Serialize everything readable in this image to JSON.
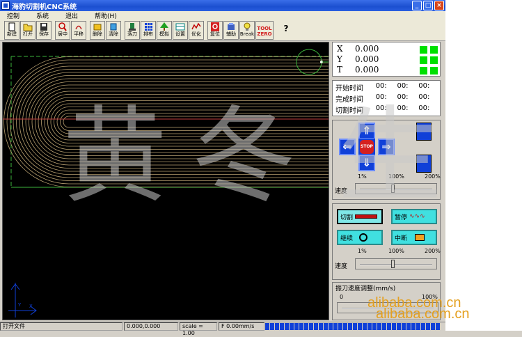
{
  "window": {
    "title": "海豹切割机CNC系统",
    "minimize": "_",
    "maximize": "□",
    "close": "×"
  },
  "menu": [
    "控制",
    "系统",
    "退出",
    "帮助(H)"
  ],
  "toolbar": [
    {
      "label": "新建",
      "icon": "new-file-icon"
    },
    {
      "label": "打开",
      "icon": "open-folder-icon"
    },
    {
      "label": "保存",
      "icon": "save-disk-icon"
    },
    {
      "label": "居中",
      "icon": "magnifier-icon"
    },
    {
      "label": "平移",
      "icon": "pan-icon"
    },
    {
      "label": "删除",
      "icon": "delete-icon"
    },
    {
      "label": "清除",
      "icon": "clear-icon"
    },
    {
      "label": "落刀",
      "icon": "blade-down-icon"
    },
    {
      "label": "排布",
      "icon": "grid-icon"
    },
    {
      "label": "模拟",
      "icon": "tree-icon"
    },
    {
      "label": "设置",
      "icon": "settings-icon"
    },
    {
      "label": "优化",
      "icon": "optimize-icon"
    },
    {
      "label": "复位",
      "icon": "reset-icon"
    },
    {
      "label": "辅助",
      "icon": "assist-icon"
    },
    {
      "label": "Break",
      "icon": "bulb-icon"
    },
    {
      "label": "TOOL ZERO",
      "icon": "tool-zero-icon"
    },
    {
      "label": "?",
      "icon": "help-icon"
    }
  ],
  "coords": {
    "x_label": "X",
    "x_value": "0.000",
    "y_label": "Y",
    "y_value": "0.000",
    "t_label": "T",
    "t_value": "0.000"
  },
  "times": [
    {
      "label": "开始时间",
      "h": "00:",
      "m": "00:",
      "s": "00:"
    },
    {
      "label": "完成时间",
      "h": "00:",
      "m": "00:",
      "s": "00:"
    },
    {
      "label": "切割时间",
      "h": "00:",
      "m": "00:",
      "s": "00:"
    }
  ],
  "jog": {
    "up": "⇑",
    "down": "⇓",
    "left": "⇐",
    "right": "⇒",
    "stop": "STOP",
    "pct_min": "1%",
    "pct_mid": "100%",
    "pct_max": "200%",
    "speed_label": "速度",
    "speed_level": 0.45
  },
  "control": {
    "cut_label": "切割",
    "pause_label": "暂停",
    "continue_label": "继续",
    "interrupt_label": "中断",
    "pct_min": "1%",
    "pct_mid": "100%",
    "pct_max": "200%",
    "speed_label": "速度",
    "speed_level": 0.45
  },
  "feed": {
    "title": "振刀速度调整(mm/s)",
    "min": "0",
    "max": "100%"
  },
  "status": {
    "message": "打开文件",
    "position": "0.000,0.000",
    "scale": "scale = 1.00",
    "feed": "F 0.00mm/s",
    "progress_blocks": 36
  },
  "watermark": {
    "chars": [
      "黄",
      "冬",
      "生"
    ],
    "site": "alibaba.com.cn"
  },
  "colors": {
    "canvas_bg": "#000000",
    "path": "#b8a070",
    "guide": "#3cb43c",
    "jog_blue": "#1040d8",
    "indicator_green": "#00e000",
    "ctrl_cyan": "#40e0e0"
  }
}
